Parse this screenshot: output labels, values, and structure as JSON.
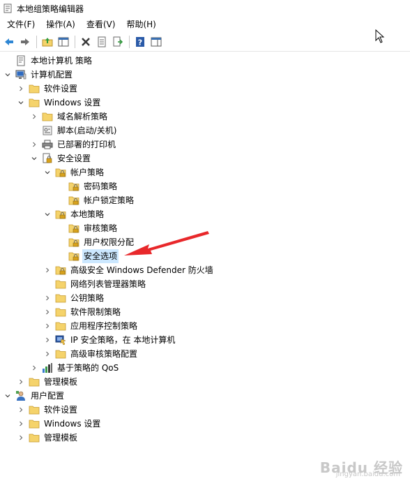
{
  "window": {
    "title": "本地组策略编辑器"
  },
  "menu": [
    {
      "label": "文件(F)"
    },
    {
      "label": "操作(A)"
    },
    {
      "label": "查看(V)"
    },
    {
      "label": "帮助(H)"
    }
  ],
  "toolbar": [
    {
      "icon": "back-arrow-icon"
    },
    {
      "icon": "forward-arrow-icon"
    },
    {
      "icon": "up-folder-icon"
    },
    {
      "icon": "show-hide-tree-icon"
    },
    {
      "icon": "delete-icon"
    },
    {
      "icon": "properties-icon"
    },
    {
      "icon": "export-list-icon"
    },
    {
      "icon": "help-icon"
    },
    {
      "icon": "show-pane-icon"
    }
  ],
  "tree": [
    {
      "label": "本地计算机 策略",
      "depth": 0,
      "expander": "none",
      "icon": "policy-doc"
    },
    {
      "label": "计算机配置",
      "depth": 0,
      "expander": "expanded",
      "icon": "computer"
    },
    {
      "label": "软件设置",
      "depth": 1,
      "expander": "collapsed",
      "icon": "folder"
    },
    {
      "label": "Windows 设置",
      "depth": 1,
      "expander": "expanded",
      "icon": "folder"
    },
    {
      "label": "域名解析策略",
      "depth": 2,
      "expander": "collapsed",
      "icon": "folder"
    },
    {
      "label": "脚本(启动/关机)",
      "depth": 2,
      "expander": "none",
      "icon": "script"
    },
    {
      "label": "已部署的打印机",
      "depth": 2,
      "expander": "collapsed",
      "icon": "printer"
    },
    {
      "label": "安全设置",
      "depth": 2,
      "expander": "expanded",
      "icon": "security"
    },
    {
      "label": "帐户策略",
      "depth": 3,
      "expander": "expanded",
      "icon": "lock-folder"
    },
    {
      "label": "密码策略",
      "depth": 4,
      "expander": "none",
      "icon": "lock-folder"
    },
    {
      "label": "帐户锁定策略",
      "depth": 4,
      "expander": "none",
      "icon": "lock-folder"
    },
    {
      "label": "本地策略",
      "depth": 3,
      "expander": "expanded",
      "icon": "lock-folder"
    },
    {
      "label": "审核策略",
      "depth": 4,
      "expander": "none",
      "icon": "lock-folder"
    },
    {
      "label": "用户权限分配",
      "depth": 4,
      "expander": "none",
      "icon": "lock-folder"
    },
    {
      "label": "安全选项",
      "depth": 4,
      "expander": "none",
      "icon": "lock-folder",
      "selected": true
    },
    {
      "label": "高级安全 Windows Defender 防火墙",
      "depth": 3,
      "expander": "collapsed",
      "icon": "lock-folder"
    },
    {
      "label": "网络列表管理器策略",
      "depth": 3,
      "expander": "none",
      "icon": "folder"
    },
    {
      "label": "公钥策略",
      "depth": 3,
      "expander": "collapsed",
      "icon": "folder"
    },
    {
      "label": "软件限制策略",
      "depth": 3,
      "expander": "collapsed",
      "icon": "folder"
    },
    {
      "label": "应用程序控制策略",
      "depth": 3,
      "expander": "collapsed",
      "icon": "folder"
    },
    {
      "label": "IP 安全策略，在 本地计算机",
      "depth": 3,
      "expander": "collapsed",
      "icon": "ipsec"
    },
    {
      "label": "高级审核策略配置",
      "depth": 3,
      "expander": "collapsed",
      "icon": "folder"
    },
    {
      "label": "基于策略的 QoS",
      "depth": 2,
      "expander": "collapsed",
      "icon": "qos"
    },
    {
      "label": "管理模板",
      "depth": 1,
      "expander": "collapsed",
      "icon": "folder"
    },
    {
      "label": "用户配置",
      "depth": 0,
      "expander": "expanded",
      "icon": "user"
    },
    {
      "label": "软件设置",
      "depth": 1,
      "expander": "collapsed",
      "icon": "folder"
    },
    {
      "label": "Windows 设置",
      "depth": 1,
      "expander": "collapsed",
      "icon": "folder"
    },
    {
      "label": "管理模板",
      "depth": 1,
      "expander": "collapsed",
      "icon": "folder"
    }
  ],
  "watermark": {
    "main": "Baidu 经验",
    "sub": "jingyan.baidu.com"
  },
  "colors": {
    "selection": "#cce8ff",
    "arrow": "#e8282b",
    "folder": "#f5d36b"
  }
}
